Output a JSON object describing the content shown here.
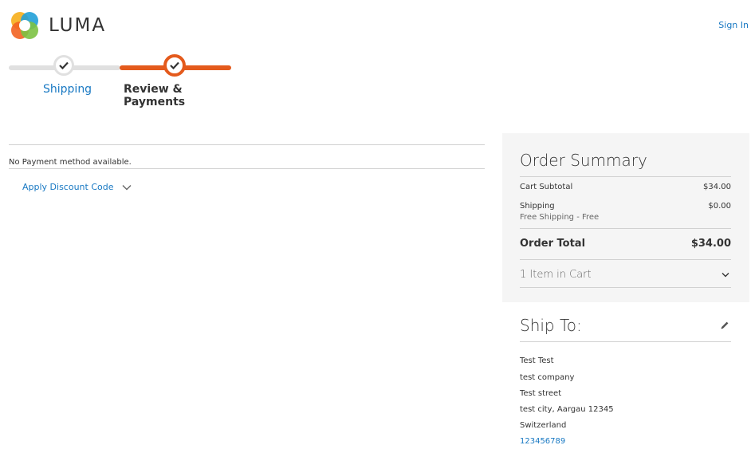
{
  "header": {
    "logo_text": "LUMA",
    "sign_in": "Sign In"
  },
  "progress": {
    "steps": [
      {
        "label": "Shipping",
        "state": "complete"
      },
      {
        "label": "Review & Payments",
        "state": "active"
      }
    ]
  },
  "payment": {
    "message": "No Payment method available.",
    "discount_label": "Apply Discount Code"
  },
  "summary": {
    "title": "Order Summary",
    "cart_subtotal_label": "Cart Subtotal",
    "cart_subtotal_value": "$34.00",
    "shipping_label": "Shipping",
    "shipping_method": "Free Shipping - Free",
    "shipping_value": "$0.00",
    "total_label": "Order Total",
    "total_value": "$34.00",
    "items_label": "1 Item in Cart"
  },
  "ship_to": {
    "title": "Ship To:",
    "name": "Test Test",
    "company": "test company",
    "street": "Test street",
    "city_line": "test city, Aargau 12345",
    "country": "Switzerland",
    "phone": "123456789"
  },
  "colors": {
    "accent_orange": "#e45a1c",
    "link_blue": "#1979c3",
    "summary_bg": "#f5f5f5"
  }
}
